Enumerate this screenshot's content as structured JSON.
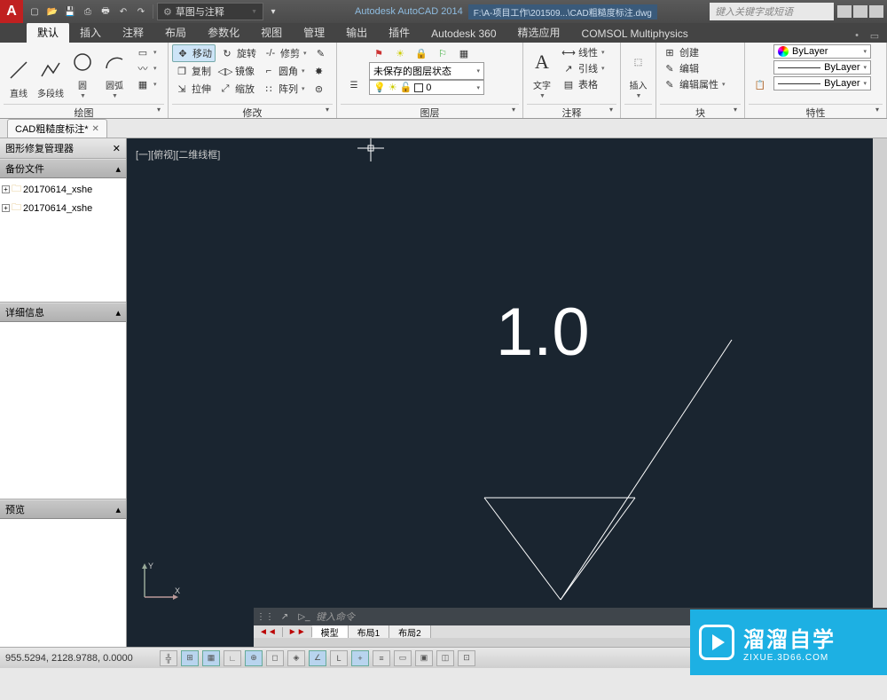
{
  "title": {
    "app": "Autodesk AutoCAD 2014",
    "path": "F:\\A-项目工作\\201509...\\CAD粗糙度标注.dwg",
    "search_ph": "键入关键字或短语",
    "workspace": "草图与注释"
  },
  "tabs": [
    "默认",
    "插入",
    "注释",
    "布局",
    "参数化",
    "视图",
    "管理",
    "输出",
    "插件",
    "Autodesk 360",
    "精选应用",
    "COMSOL Multiphysics"
  ],
  "ribbon": {
    "draw": {
      "title": "绘图",
      "line": "直线",
      "pline": "多段线",
      "circle": "圆",
      "arc": "圆弧"
    },
    "modify": {
      "title": "修改",
      "move": "移动",
      "rotate": "旋转",
      "trim": "修剪",
      "copy": "复制",
      "mirror": "镜像",
      "fillet": "圆角",
      "stretch": "拉伸",
      "scale": "缩放",
      "array": "阵列"
    },
    "layer": {
      "title": "图层",
      "state": "未保存的图层状态",
      "cur": "0"
    },
    "annot": {
      "title": "注释",
      "text": "文字",
      "linear": "线性",
      "leader": "引线",
      "table": "表格"
    },
    "insert": {
      "title": "插入",
      "btn": "插入"
    },
    "block": {
      "title": "块",
      "create": "创建",
      "edit": "编辑",
      "editattr": "编辑属性"
    },
    "prop": {
      "title": "特性",
      "bylayer": "ByLayer"
    }
  },
  "doc_tab": "CAD粗糙度标注*",
  "side": {
    "hdr": "图形修复管理器",
    "backup": "备份文件",
    "files": [
      "20170614_xshe",
      "20170614_xshe"
    ],
    "detail": "详细信息",
    "preview": "预览"
  },
  "canvas": {
    "vp": "[一][俯视][二维线框]",
    "value": "1.0"
  },
  "cmd": {
    "prompt": "键入命令"
  },
  "layout": {
    "model": "模型",
    "l1": "布局1",
    "l2": "布局2"
  },
  "status": {
    "coords": "955.5294, 2128.9788, 0.0000"
  },
  "watermark": {
    "t": "溜溜自学",
    "s": "ZIXUE.3D66.COM"
  }
}
